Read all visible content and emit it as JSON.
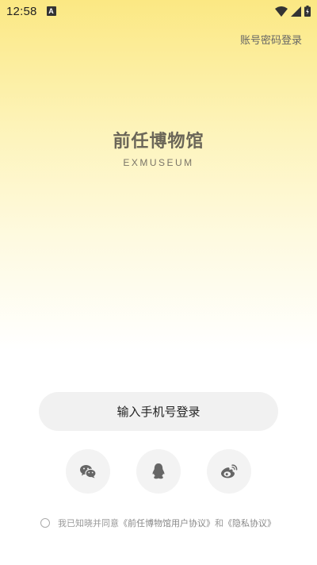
{
  "status_bar": {
    "time": "12:58",
    "notification_letter": "A"
  },
  "header": {
    "account_login_label": "账号密码登录"
  },
  "brand": {
    "name_cn": "前任博物馆",
    "name_en": "EXMUSEUM"
  },
  "main": {
    "phone_login_label": "输入手机号登录"
  },
  "social_login": {
    "items": [
      {
        "icon": "wechat-icon"
      },
      {
        "icon": "qq-icon"
      },
      {
        "icon": "weibo-icon"
      }
    ]
  },
  "agreement": {
    "prefix": "我已知晓并同意",
    "user_agreement": "《前任博物馆用户协议》",
    "connector": "和",
    "privacy_policy": "《隐私协议》"
  },
  "colors": {
    "gradient_top": "#fbe883",
    "button_bg": "#f1f1f1",
    "brand_text": "#6b6658"
  }
}
